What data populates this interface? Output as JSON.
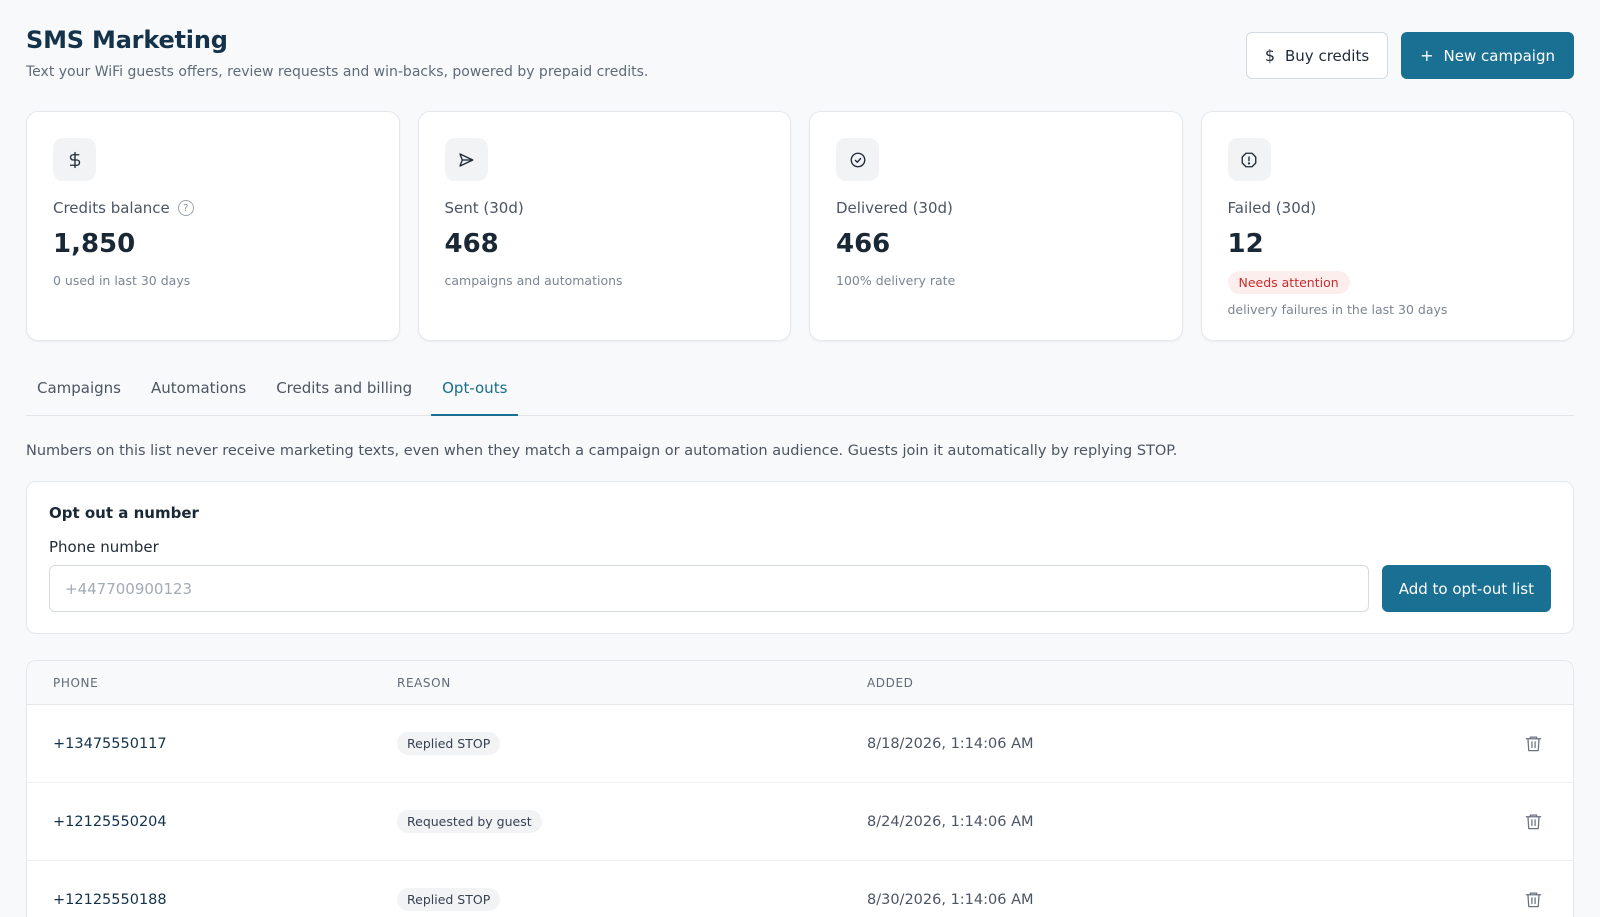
{
  "header": {
    "title": "SMS Marketing",
    "subtitle": "Text your WiFi guests offers, review requests and win-backs, powered by prepaid credits.",
    "buy_credits_label": "Buy credits",
    "new_campaign_label": "New campaign",
    "buy_credits_icon": "$",
    "new_campaign_icon": "+"
  },
  "stats": [
    {
      "icon": "dollar-icon",
      "label": "Credits balance",
      "value": "1,850",
      "note": "0 used in last 30 days"
    },
    {
      "icon": "send-icon",
      "label": "Sent (30d)",
      "value": "468",
      "note": "campaigns and automations"
    },
    {
      "icon": "check-circle-icon",
      "label": "Delivered (30d)",
      "value": "466",
      "note": "100% delivery rate"
    },
    {
      "icon": "alert-icon",
      "label": "Failed (30d)",
      "value": "12",
      "badge": "Needs attention",
      "note": "delivery failures in the last 30 days"
    }
  ],
  "help_glyph": "?",
  "tabs": [
    {
      "label": "Campaigns",
      "active": false
    },
    {
      "label": "Automations",
      "active": false
    },
    {
      "label": "Credits and billing",
      "active": false
    },
    {
      "label": "Opt-outs",
      "active": true
    }
  ],
  "optouts": {
    "intro": "Numbers on this list never receive marketing texts, even when they match a campaign or automation audience. Guests join it automatically by replying STOP.",
    "form_title": "Opt out a number",
    "field_label": "Phone number",
    "placeholder": "+447700900123",
    "input_value": "",
    "add_label": "Add to opt-out list"
  },
  "table": {
    "columns": [
      "PHONE",
      "REASON",
      "ADDED"
    ],
    "rows": [
      {
        "phone": "+13475550117",
        "reason": "Replied STOP",
        "added": "8/18/2026, 1:14:06 AM"
      },
      {
        "phone": "+12125550204",
        "reason": "Requested by guest",
        "added": "8/24/2026, 1:14:06 AM"
      },
      {
        "phone": "+12125550188",
        "reason": "Replied STOP",
        "added": "8/30/2026, 1:14:06 AM"
      }
    ]
  },
  "colors": {
    "primary": "#1a7092",
    "danger": "#c62e2e",
    "title": "#14324a"
  }
}
